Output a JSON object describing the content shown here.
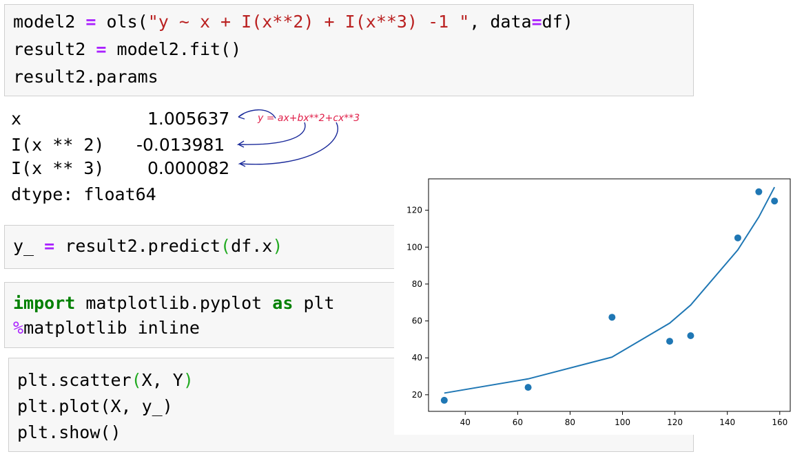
{
  "cells": [
    {
      "lines": [
        [
          {
            "t": "model2 ",
            "c": ""
          },
          {
            "t": "=",
            "c": "op"
          },
          {
            "t": " ols(",
            "c": ""
          },
          {
            "t": "\"y ~ x + I(x**2) + I(x**3) -1 \"",
            "c": "str"
          },
          {
            "t": ", data",
            "c": ""
          },
          {
            "t": "=",
            "c": "op"
          },
          {
            "t": "df)",
            "c": ""
          }
        ],
        [
          {
            "t": "result2 ",
            "c": ""
          },
          {
            "t": "=",
            "c": "op"
          },
          {
            "t": " model2.fit()",
            "c": ""
          }
        ],
        [
          {
            "t": "result2.params",
            "c": ""
          }
        ]
      ]
    },
    {
      "lines": [
        [
          {
            "t": "y_ ",
            "c": ""
          },
          {
            "t": "=",
            "c": "op"
          },
          {
            "t": " result2.predict",
            "c": ""
          },
          {
            "t": "(",
            "c": "par"
          },
          {
            "t": "df.x",
            "c": ""
          },
          {
            "t": ")",
            "c": "par"
          }
        ]
      ]
    },
    {
      "lines": [
        [
          {
            "t": "import",
            "c": "kw"
          },
          {
            "t": " matplotlib.pyplot ",
            "c": ""
          },
          {
            "t": "as",
            "c": "kw"
          },
          {
            "t": " plt",
            "c": ""
          }
        ],
        [
          {
            "t": "%",
            "c": "mag"
          },
          {
            "t": "matplotlib inline",
            "c": ""
          }
        ]
      ]
    },
    {
      "lines": [
        [
          {
            "t": "plt.scatter",
            "c": ""
          },
          {
            "t": "(",
            "c": "par"
          },
          {
            "t": "X, Y",
            "c": ""
          },
          {
            "t": ")",
            "c": "par"
          }
        ],
        [
          {
            "t": "plt.plot(X, y_)",
            "c": ""
          }
        ],
        [
          {
            "t": "plt.show()",
            "c": ""
          }
        ]
      ]
    }
  ],
  "params_output": {
    "rows": [
      {
        "name": "x",
        "value": "1.005637"
      },
      {
        "name": "I(x ** 2)",
        "value": "-0.013981"
      },
      {
        "name": "I(x ** 3)",
        "value": "0.000082"
      }
    ],
    "dtype": "dtype: float64"
  },
  "annotation": {
    "formula": "y = ax+bx**2+cx**3",
    "color": "#e0204a",
    "arrow_color": "#1a2a9a"
  },
  "chart_data": {
    "type": "scatter",
    "scatter": {
      "x": [
        32,
        64,
        96,
        118,
        126,
        144,
        152,
        158
      ],
      "y": [
        17,
        24,
        62,
        49,
        52,
        105,
        130,
        125
      ]
    },
    "line": {
      "x": [
        32,
        64,
        96,
        118,
        126,
        144,
        152,
        158
      ],
      "y": [
        20.9,
        28.6,
        40.4,
        58.8,
        68.6,
        98.5,
        116.3,
        132.5
      ]
    },
    "xlim": [
      26,
      164
    ],
    "ylim": [
      11,
      137
    ],
    "xticks": [
      40,
      60,
      80,
      100,
      120,
      140,
      160
    ],
    "yticks": [
      20,
      40,
      60,
      80,
      100,
      120
    ],
    "color": "#1f77b4"
  }
}
